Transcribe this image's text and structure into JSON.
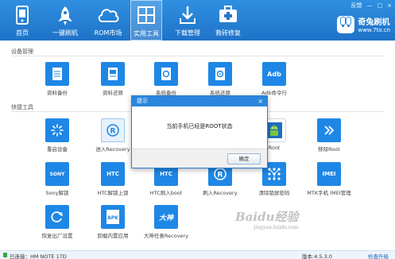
{
  "window": {
    "feedback": "反馈",
    "min": "—",
    "max": "□",
    "close": "×"
  },
  "nav": {
    "items": [
      {
        "label": "首页",
        "icon": "phone-icon"
      },
      {
        "label": "一键刷机",
        "icon": "rocket-icon"
      },
      {
        "label": "ROM市场",
        "icon": "cloud-icon"
      },
      {
        "label": "实用工具",
        "icon": "grid-icon",
        "active": true
      },
      {
        "label": "下载管理",
        "icon": "download-icon"
      },
      {
        "label": "救砖修复",
        "icon": "first-aid-icon"
      }
    ]
  },
  "brand": {
    "name": "奇兔刷机",
    "url": "www.7to.cn"
  },
  "sections": {
    "device": "设备管理",
    "quick": "快捷工具"
  },
  "device_tools": [
    {
      "label": "资料备份",
      "icon": "doc-icon"
    },
    {
      "label": "资料还原",
      "icon": "doc-restore-icon"
    },
    {
      "label": "系统备份",
      "icon": "system-backup-icon"
    },
    {
      "label": "系统还原",
      "icon": "system-restore-icon"
    },
    {
      "label": "Adb命令行",
      "icon": "adb-icon",
      "text": "Adb"
    }
  ],
  "quick_tools": [
    {
      "label": "重启设备",
      "icon": "spinner-icon"
    },
    {
      "label": "进入Recovery",
      "icon": "recovery-icon",
      "text": "R"
    },
    {
      "label": "",
      "icon": "blank-icon"
    },
    {
      "label": "",
      "icon": "blank-icon"
    },
    {
      "label": "Root",
      "icon": "android-icon"
    },
    {
      "label": "移除Root",
      "icon": "remove-root-icon"
    },
    {
      "label": "Sony解锁",
      "icon": "sony-icon",
      "text": "SONY"
    },
    {
      "label": "HTC解锁上锁",
      "icon": "htc-lock-icon",
      "text": "HTC"
    },
    {
      "label": "HTC刷入boot",
      "icon": "htc-boot-icon",
      "text": "HTC"
    },
    {
      "label": "刷入Recovery",
      "icon": "flash-recovery-icon",
      "text": "R"
    },
    {
      "label": "清除锁屏密码",
      "icon": "pattern-lock-icon"
    },
    {
      "label": "MTK手机 IMEI管理",
      "icon": "imei-icon",
      "text": "IMEI"
    },
    {
      "label": "恢复出厂设置",
      "icon": "factory-reset-icon"
    },
    {
      "label": "卸载内置应用",
      "icon": "apk-icon",
      "text": "APK"
    },
    {
      "label": "大神任意Recovery",
      "icon": "dashen-recovery-icon",
      "text": "大神"
    }
  ],
  "dialog": {
    "title": "提示",
    "message": "当前手机已经是ROOT状态",
    "ok": "确定",
    "close": "×"
  },
  "status": {
    "connected": "已连接：HM NOTE 1TD",
    "version": "版本:4.5.3.0",
    "update": "检查升级"
  },
  "watermark": {
    "text": "Baidu经验",
    "sub": "jingyan.baidu.com"
  }
}
